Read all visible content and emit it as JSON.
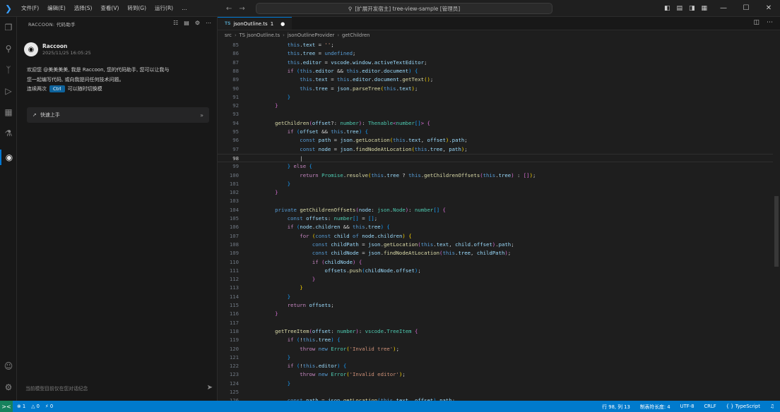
{
  "titlebar": {
    "menu": [
      "文件(F)",
      "编辑(E)",
      "选择(S)",
      "查看(V)",
      "转到(G)",
      "运行(R)"
    ],
    "more": "…",
    "back": "←",
    "forward": "→",
    "search_text": "[扩展开发宿主] tree-view-sample [管理员]",
    "window_controls": [
      "—",
      "☐",
      "✕"
    ]
  },
  "sidebar": {
    "title": "RACCOON: 代码助手",
    "message": {
      "author": "Raccoon",
      "time": "2025/11/25 16:05:25",
      "text_line1": "欢迎您 @美美美美, 我是 Raccoon, 您的代码助手, 您可以让我与",
      "text_line2": "您一起编写代码, 或向我提问任何技术问题。",
      "text_line3_pre": "连续两次",
      "key": "Ctrl",
      "text_line3_post": "可以随时切换模"
    },
    "quickstart_label": "快速上手",
    "input_placeholder": "当前模型目前仅在您对话纪念"
  },
  "editor": {
    "tab": {
      "lang_badge": "TS",
      "filename": "jsonOutline.ts",
      "problem_count": "1",
      "modified_dot": "●"
    },
    "breadcrumb": [
      "src",
      "TS jsonOutline.ts",
      "jsonOutlineProvider",
      "getChildren"
    ]
  },
  "statusbar": {
    "remote_icon": "><",
    "errors": "⊗ 1",
    "warnings": "△ 0",
    "ports": "⚡ 0",
    "position": "行 98, 列 13",
    "indent": "制表符长度: 4",
    "encoding": "UTF-8",
    "eol": "CRLF",
    "language": "{ } TypeScript"
  },
  "code_lines": [
    {
      "n": "85",
      "html": "            <span class='th'>this</span><span class='pl'>.</span><span class='var'>text</span><span class='pl'> = </span><span class='str'>''</span><span class='pl'>;</span>"
    },
    {
      "n": "86",
      "html": "            <span class='th'>this</span><span class='pl'>.</span><span class='var'>tree</span><span class='pl'> = </span><span class='th'>undefined</span><span class='pl'>;</span>"
    },
    {
      "n": "87",
      "html": "            <span class='th'>this</span><span class='pl'>.</span><span class='var'>editor</span><span class='pl'> = </span><span class='var'>vscode</span><span class='pl'>.</span><span class='var'>window</span><span class='pl'>.</span><span class='var'>activeTextEditor</span><span class='pl'>;</span>"
    },
    {
      "n": "88",
      "html": "            <span class='kw'>if</span><span class='pl'> </span><span class='b3'>(</span><span class='th'>this</span><span class='pl'>.</span><span class='var'>editor</span><span class='pl'> &amp;&amp; </span><span class='th'>this</span><span class='pl'>.</span><span class='var'>editor</span><span class='pl'>.</span><span class='var'>document</span><span class='b3'>)</span><span class='pl'> </span><span class='b3'>{</span>"
    },
    {
      "n": "89",
      "html": "                <span class='th'>this</span><span class='pl'>.</span><span class='var'>text</span><span class='pl'> = </span><span class='th'>this</span><span class='pl'>.</span><span class='var'>editor</span><span class='pl'>.</span><span class='var'>document</span><span class='pl'>.</span><span class='fn'>getText</span><span class='b1'>()</span><span class='pl'>;</span>"
    },
    {
      "n": "90",
      "html": "                <span class='th'>this</span><span class='pl'>.</span><span class='var'>tree</span><span class='pl'> = </span><span class='var'>json</span><span class='pl'>.</span><span class='fn'>parseTree</span><span class='b1'>(</span><span class='th'>this</span><span class='pl'>.</span><span class='var'>text</span><span class='b1'>)</span><span class='pl'>;</span>"
    },
    {
      "n": "91",
      "html": "            <span class='b3'>}</span>"
    },
    {
      "n": "92",
      "html": "        <span class='b2'>}</span>"
    },
    {
      "n": "93",
      "html": ""
    },
    {
      "n": "94",
      "html": "        <span class='fn'>getChildren</span><span class='b2'>(</span><span class='var'>offset</span><span class='pl'>?: </span><span class='ty'>number</span><span class='b2'>)</span><span class='pl'>: </span><span class='ty'>Thenable</span><span class='b2'>&lt;</span><span class='ty'>number</span><span class='b3'>[]</span><span class='b2'>&gt;</span><span class='pl'> </span><span class='b2'>{</span>"
    },
    {
      "n": "95",
      "html": "            <span class='kw'>if</span><span class='pl'> </span><span class='b3'>(</span><span class='var'>offset</span><span class='pl'> &amp;&amp; </span><span class='th'>this</span><span class='pl'>.</span><span class='var'>tree</span><span class='b3'>)</span><span class='pl'> </span><span class='b3'>{</span>"
    },
    {
      "n": "96",
      "html": "                <span class='kw2'>const</span><span class='pl'> </span><span class='var'>path</span><span class='pl'> = </span><span class='var'>json</span><span class='pl'>.</span><span class='fn'>getLocation</span><span class='b1'>(</span><span class='th'>this</span><span class='pl'>.</span><span class='var'>text</span><span class='pl'>, </span><span class='var'>offset</span><span class='b1'>)</span><span class='pl'>.</span><span class='var'>path</span><span class='pl'>;</span>"
    },
    {
      "n": "97",
      "html": "                <span class='kw2'>const</span><span class='pl'> </span><span class='var'>node</span><span class='pl'> = </span><span class='var'>json</span><span class='pl'>.</span><span class='fn'>findNodeAtLocation</span><span class='b1'>(</span><span class='th'>this</span><span class='pl'>.</span><span class='var'>tree</span><span class='pl'>, </span><span class='var'>path</span><span class='b1'>)</span><span class='pl'>;</span>"
    },
    {
      "n": "98",
      "html": "                <span class='pl'>|</span>"
    },
    {
      "n": "99",
      "html": "            <span class='b3'>}</span><span class='pl'> </span><span class='kw'>else</span><span class='pl'> </span><span class='b3'>{</span>"
    },
    {
      "n": "100",
      "html": "                <span class='kw'>return</span><span class='pl'> </span><span class='ty'>Promise</span><span class='pl'>.</span><span class='fn'>resolve</span><span class='b1'>(</span><span class='th'>this</span><span class='pl'>.</span><span class='var'>tree</span><span class='pl'> ? </span><span class='th'>this</span><span class='pl'>.</span><span class='fn'>getChildrenOffsets</span><span class='b2'>(</span><span class='th'>this</span><span class='pl'>.</span><span class='var'>tree</span><span class='b2'>)</span><span class='pl'> : </span><span class='b2'>[]</span><span class='b1'>)</span><span class='pl'>;</span>"
    },
    {
      "n": "101",
      "html": "            <span class='b3'>}</span>"
    },
    {
      "n": "102",
      "html": "        <span class='b2'>}</span>"
    },
    {
      "n": "103",
      "html": ""
    },
    {
      "n": "104",
      "html": "        <span class='kw2'>private</span><span class='pl'> </span><span class='fn'>getChildrenOffsets</span><span class='b2'>(</span><span class='var'>node</span><span class='pl'>: </span><span class='ty'>json</span><span class='pl'>.</span><span class='ty'>Node</span><span class='b2'>)</span><span class='pl'>: </span><span class='ty'>number</span><span class='b3'>[]</span><span class='pl'> </span><span class='b2'>{</span>"
    },
    {
      "n": "105",
      "html": "            <span class='kw2'>const</span><span class='pl'> </span><span class='var'>offsets</span><span class='pl'>: </span><span class='ty'>number</span><span class='b3'>[]</span><span class='pl'> = </span><span class='b3'>[]</span><span class='pl'>;</span>"
    },
    {
      "n": "106",
      "html": "            <span class='kw'>if</span><span class='pl'> </span><span class='b3'>(</span><span class='var'>node</span><span class='pl'>.</span><span class='var'>children</span><span class='pl'> &amp;&amp; </span><span class='th'>this</span><span class='pl'>.</span><span class='var'>tree</span><span class='b3'>)</span><span class='pl'> </span><span class='b3'>{</span>"
    },
    {
      "n": "107",
      "html": "                <span class='kw'>for</span><span class='pl'> </span><span class='b1'>(</span><span class='kw2'>const</span><span class='pl'> </span><span class='var'>child</span><span class='pl'> </span><span class='kw2'>of</span><span class='pl'> </span><span class='var'>node</span><span class='pl'>.</span><span class='var'>children</span><span class='b1'>)</span><span class='pl'> </span><span class='b1'>{</span>"
    },
    {
      "n": "108",
      "html": "                    <span class='kw2'>const</span><span class='pl'> </span><span class='var'>childPath</span><span class='pl'> = </span><span class='var'>json</span><span class='pl'>.</span><span class='fn'>getLocation</span><span class='b2'>(</span><span class='th'>this</span><span class='pl'>.</span><span class='var'>text</span><span class='pl'>, </span><span class='var'>child</span><span class='pl'>.</span><span class='var'>offset</span><span class='b2'>)</span><span class='pl'>.</span><span class='var'>path</span><span class='pl'>;</span>"
    },
    {
      "n": "109",
      "html": "                    <span class='kw2'>const</span><span class='pl'> </span><span class='var'>childNode</span><span class='pl'> = </span><span class='var'>json</span><span class='pl'>.</span><span class='fn'>findNodeAtLocation</span><span class='b2'>(</span><span class='th'>this</span><span class='pl'>.</span><span class='var'>tree</span><span class='pl'>, </span><span class='var'>childPath</span><span class='b2'>)</span><span class='pl'>;</span>"
    },
    {
      "n": "110",
      "html": "                    <span class='kw'>if</span><span class='pl'> </span><span class='b2'>(</span><span class='var'>childNode</span><span class='b2'>)</span><span class='pl'> </span><span class='b2'>{</span>"
    },
    {
      "n": "111",
      "html": "                        <span class='var'>offsets</span><span class='pl'>.</span><span class='fn'>push</span><span class='b3'>(</span><span class='var'>childNode</span><span class='pl'>.</span><span class='var'>offset</span><span class='b3'>)</span><span class='pl'>;</span>"
    },
    {
      "n": "112",
      "html": "                    <span class='b2'>}</span>"
    },
    {
      "n": "113",
      "html": "                <span class='b1'>}</span>"
    },
    {
      "n": "114",
      "html": "            <span class='b3'>}</span>"
    },
    {
      "n": "115",
      "html": "            <span class='kw'>return</span><span class='pl'> </span><span class='var'>offsets</span><span class='pl'>;</span>"
    },
    {
      "n": "116",
      "html": "        <span class='b2'>}</span>"
    },
    {
      "n": "117",
      "html": ""
    },
    {
      "n": "118",
      "html": "        <span class='fn'>getTreeItem</span><span class='b2'>(</span><span class='var'>offset</span><span class='pl'>: </span><span class='ty'>number</span><span class='b2'>)</span><span class='pl'>: </span><span class='ty'>vscode</span><span class='pl'>.</span><span class='ty'>TreeItem</span><span class='pl'> </span><span class='b2'>{</span>"
    },
    {
      "n": "119",
      "html": "            <span class='kw'>if</span><span class='pl'> </span><span class='b3'>(</span><span class='pl'>!</span><span class='th'>this</span><span class='pl'>.</span><span class='var'>tree</span><span class='b3'>)</span><span class='pl'> </span><span class='b3'>{</span>"
    },
    {
      "n": "120",
      "html": "                <span class='kw'>throw</span><span class='pl'> </span><span class='kw2'>new</span><span class='pl'> </span><span class='ty'>Error</span><span class='b1'>(</span><span class='str'>'Invalid tree'</span><span class='b1'>)</span><span class='pl'>;</span>"
    },
    {
      "n": "121",
      "html": "            <span class='b3'>}</span>"
    },
    {
      "n": "122",
      "html": "            <span class='kw'>if</span><span class='pl'> </span><span class='b3'>(</span><span class='pl'>!</span><span class='th'>this</span><span class='pl'>.</span><span class='var'>editor</span><span class='b3'>)</span><span class='pl'> </span><span class='b3'>{</span>"
    },
    {
      "n": "123",
      "html": "                <span class='kw'>throw</span><span class='pl'> </span><span class='kw2'>new</span><span class='pl'> </span><span class='ty'>Error</span><span class='b1'>(</span><span class='str'>'Invalid editor'</span><span class='b1'>)</span><span class='pl'>;</span>"
    },
    {
      "n": "124",
      "html": "            <span class='b3'>}</span>"
    },
    {
      "n": "125",
      "html": ""
    },
    {
      "n": "126",
      "html": "            <span class='kw2'>const</span><span class='pl'> </span><span class='var'>path</span><span class='pl'> = </span><span class='var'>json</span><span class='pl'>.</span><span class='fn'>getLocation</span><span class='b3'>(</span><span class='th'>this</span><span class='pl'>.</span><span class='var'>text</span><span class='pl'>, </span><span class='var'>offset</span><span class='b3'>)</span><span class='pl'>.</span><span class='var'>path</span><span class='pl'>;</span>"
    }
  ]
}
